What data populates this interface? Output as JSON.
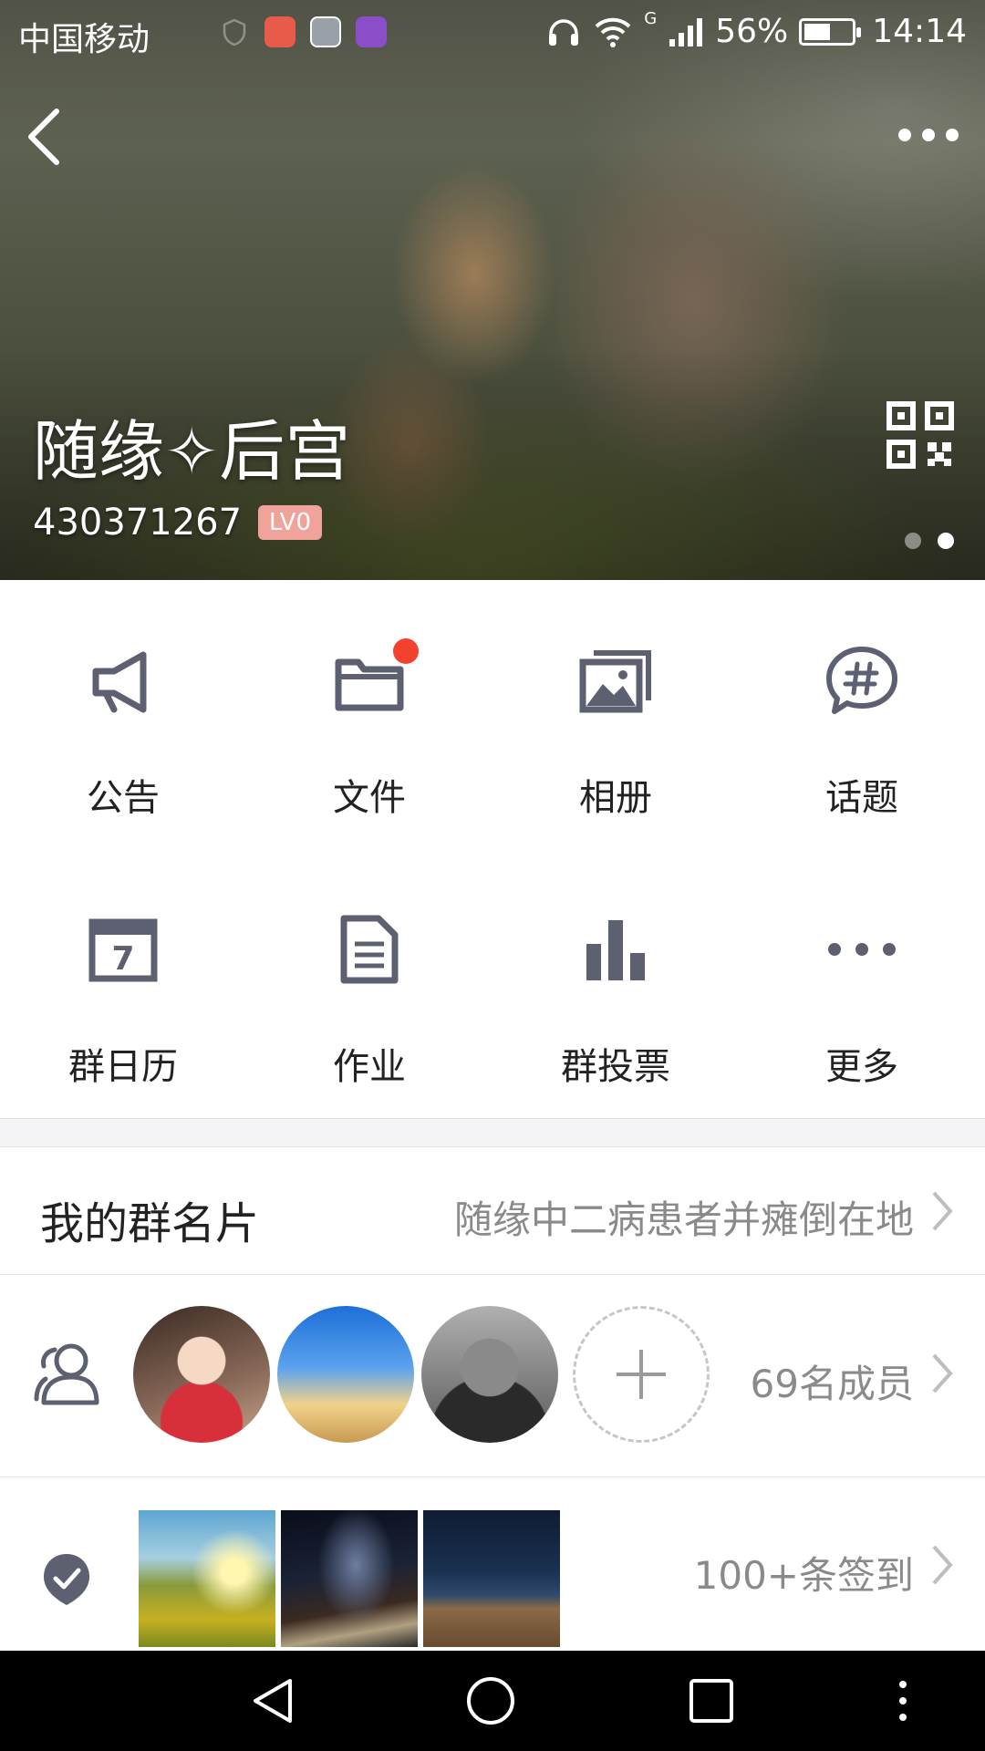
{
  "status_bar": {
    "carrier": "中国移动",
    "network": "G",
    "battery": "56%",
    "battery_level": 0.56,
    "time": "14:14",
    "icons": [
      "shield-icon",
      "app-icon-red",
      "iqiyi-app-icon",
      "gallery-app-icon",
      "headphones-icon",
      "wifi-icon",
      "signal-icon",
      "battery-icon"
    ]
  },
  "header": {
    "group_name": "随缘✧后宫",
    "group_id": "430371267",
    "level": "LV0",
    "page_index": 1,
    "page_count": 2
  },
  "functions": [
    {
      "label": "公告",
      "icon": "megaphone-icon"
    },
    {
      "label": "文件",
      "icon": "folder-icon",
      "has_badge": true
    },
    {
      "label": "相册",
      "icon": "album-icon"
    },
    {
      "label": "话题",
      "icon": "topic-hash-icon"
    },
    {
      "label": "群日历",
      "icon": "calendar-icon",
      "calendar_day": "7"
    },
    {
      "label": "作业",
      "icon": "document-icon"
    },
    {
      "label": "群投票",
      "icon": "bar-chart-icon"
    },
    {
      "label": "更多",
      "icon": "more-dots-icon"
    }
  ],
  "my_card": {
    "title": "我的群名片",
    "value": "随缘中二病患者并瘫倒在地"
  },
  "members": {
    "count_text": "69名成员"
  },
  "checkin": {
    "count_text": "100+条签到"
  },
  "colors": {
    "badge_red": "#f2412f",
    "icon_gray": "#5c6070",
    "level_badge": "#f0a39a"
  }
}
